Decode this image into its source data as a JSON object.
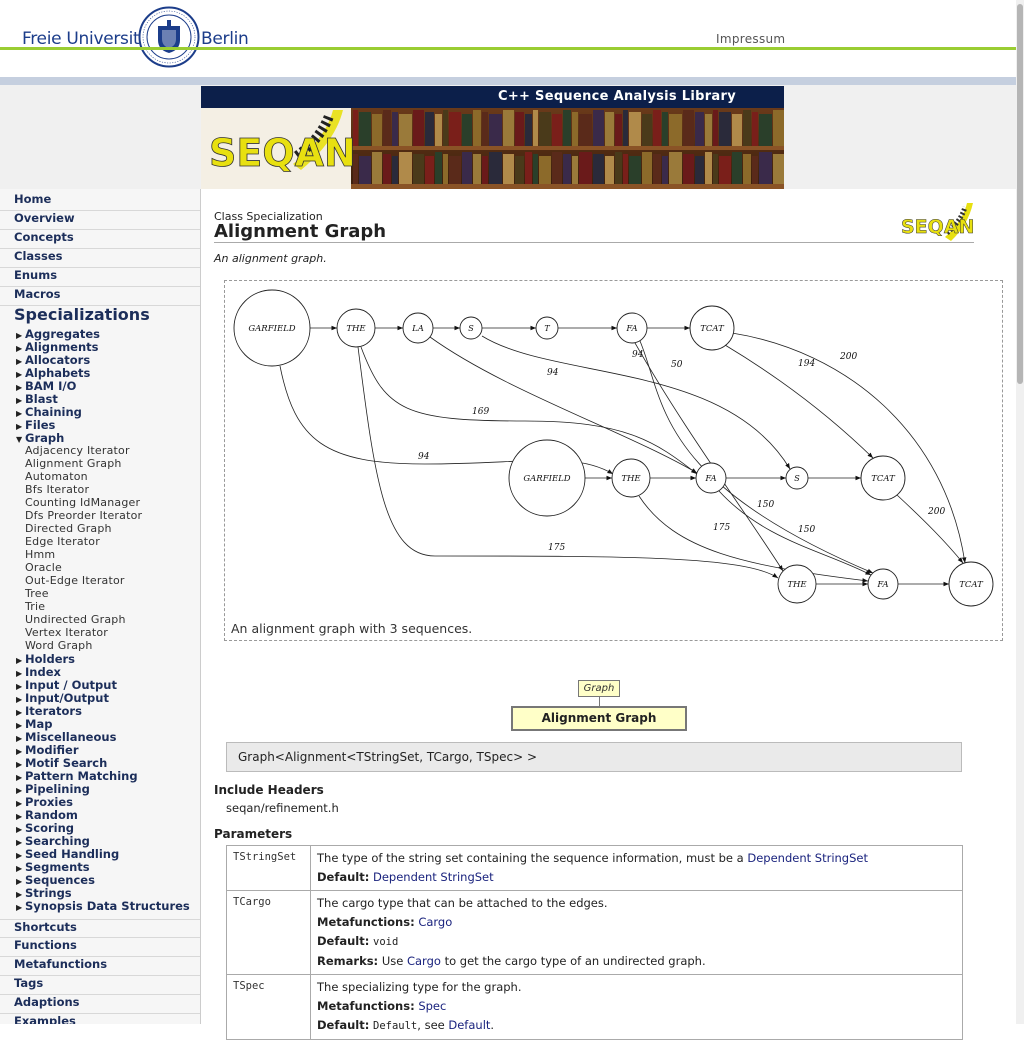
{
  "header": {
    "logo_left": "Freie Universität",
    "logo_right": "Berlin",
    "impressum": "Impressum"
  },
  "banner": {
    "title": "C++ Sequence Analysis Library",
    "logo_text": "SEQAN"
  },
  "sidebar": {
    "main_top": [
      "Home",
      "Overview",
      "Concepts",
      "Classes",
      "Enums",
      "Macros"
    ],
    "specializations_title": "Specializations",
    "spec_before": [
      "Aggregates",
      "Alignments",
      "Allocators",
      "Alphabets",
      "BAM I/O",
      "Blast",
      "Chaining",
      "Files"
    ],
    "graph_label": "Graph",
    "graph_subitems": [
      "Adjacency Iterator",
      "Alignment Graph",
      "Automaton",
      "Bfs Iterator",
      "Counting IdManager",
      "Dfs Preorder Iterator",
      "Directed Graph",
      "Edge Iterator",
      "Hmm",
      "Oracle",
      "Out-Edge Iterator",
      "Tree",
      "Trie",
      "Undirected Graph",
      "Vertex Iterator",
      "Word Graph"
    ],
    "spec_after": [
      "Holders",
      "Index",
      "Input / Output",
      "Input/Output",
      "Iterators",
      "Map",
      "Miscellaneous",
      "Modifier",
      "Motif Search",
      "Pattern Matching",
      "Pipelining",
      "Proxies",
      "Random",
      "Scoring",
      "Searching",
      "Seed Handling",
      "Segments",
      "Sequences",
      "Strings",
      "Synopsis Data Structures"
    ],
    "main_bottom": [
      "Shortcuts",
      "Functions",
      "Metafunctions",
      "Tags",
      "Adaptions",
      "Examples"
    ]
  },
  "page": {
    "class_type": "Class Specialization",
    "title": "Alignment Graph",
    "brief": "An alignment graph.",
    "figure_caption": "An alignment graph with 3 sequences.",
    "inherit_parent": "Graph",
    "inherit_self": "Alignment Graph",
    "signature": "Graph<Alignment<TStringSet, TCargo, TSpec> >",
    "include_title": "Include Headers",
    "include_value": "seqan/refinement.h",
    "params_title": "Parameters"
  },
  "graph": {
    "nodes": [
      "GARFIELD",
      "THE",
      "LA",
      "S",
      "T",
      "FA",
      "TCAT",
      "GARFIELD",
      "THE",
      "FA",
      "S",
      "TCAT",
      "THE",
      "FA",
      "TCAT"
    ],
    "edge_labels": [
      "94",
      "50",
      "194",
      "200",
      "94",
      "169",
      "94",
      "150",
      "175",
      "150",
      "175",
      "200"
    ]
  },
  "params": [
    {
      "name": "TStringSet",
      "desc_prefix": "The type of the string set containing the sequence information, must be a ",
      "desc_link": "Dependent StringSet",
      "default_label": "Default:",
      "default_link": "Dependent StringSet"
    },
    {
      "name": "TCargo",
      "desc": "The cargo type that can be attached to the edges.",
      "meta_label": "Metafunctions:",
      "meta_link": "Cargo",
      "default_label": "Default:",
      "default_code": "void",
      "remarks_label": "Remarks:",
      "remarks_prefix": "Use ",
      "remarks_link": "Cargo",
      "remarks_suffix": " to get the cargo type of an undirected graph."
    },
    {
      "name": "TSpec",
      "desc": "The specializing type for the graph.",
      "meta_label": "Metafunctions:",
      "meta_link": "Spec",
      "default_label": "Default:",
      "default_code": "Default",
      "default_sep": ", see ",
      "default_link": "Default",
      "default_end": "."
    }
  ],
  "colors": {
    "fu_blue": "#1c3d8a",
    "fu_green": "#9acd32",
    "banner_navy": "#0c1f4a",
    "link": "#1a237e",
    "seqan_yellow": "#e8e010"
  }
}
